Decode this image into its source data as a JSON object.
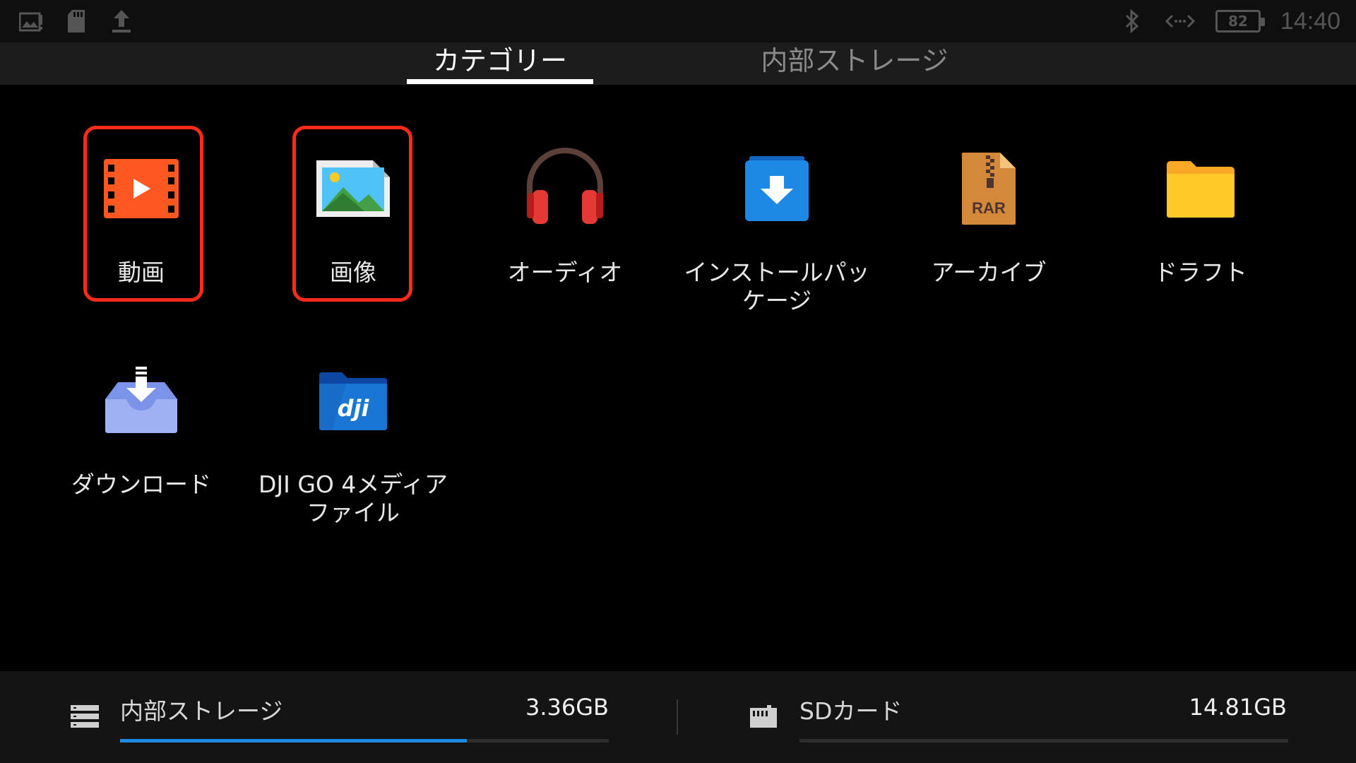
{
  "status": {
    "left_icons": [
      "photo-alert-icon",
      "sd-card-icon",
      "upload-icon"
    ],
    "bluetooth_icon": "bluetooth-icon",
    "link_icon": "link-arrows-icon",
    "battery": "82",
    "time": "14:40"
  },
  "tabs": [
    {
      "label": "カテゴリー",
      "active": true
    },
    {
      "label": "内部ストレージ",
      "active": false
    }
  ],
  "categories": [
    {
      "label": "動画",
      "icon": "video-icon",
      "highlighted": true
    },
    {
      "label": "画像",
      "icon": "image-icon",
      "highlighted": true
    },
    {
      "label": "オーディオ",
      "icon": "headphones-icon",
      "highlighted": false
    },
    {
      "label_line1": "インストールパッ",
      "label_line2": "ケージ",
      "icon": "install-package-icon",
      "highlighted": false
    },
    {
      "label": "アーカイブ",
      "icon": "rar-archive-icon",
      "rar_text": "RAR",
      "highlighted": false
    },
    {
      "label": "ドラフト",
      "icon": "folder-icon",
      "highlighted": false
    },
    {
      "label": "ダウンロード",
      "icon": "download-tray-icon",
      "highlighted": false
    },
    {
      "label_line1": "DJI GO 4メディア",
      "label_line2": "ファイル",
      "icon": "dji-folder-icon",
      "logo_text": "dji",
      "highlighted": false
    }
  ],
  "storage": {
    "internal": {
      "label": "内部ストレージ",
      "value": "3.36GB",
      "fill_fraction": 0.71,
      "icon": "storage-icon"
    },
    "sd": {
      "label": "SDカード",
      "value": "14.81GB",
      "fill_fraction": 0.0,
      "icon": "sd-card-icon"
    }
  },
  "colors": {
    "highlight": "#ff2a1a",
    "progress": "#1e88e5"
  }
}
